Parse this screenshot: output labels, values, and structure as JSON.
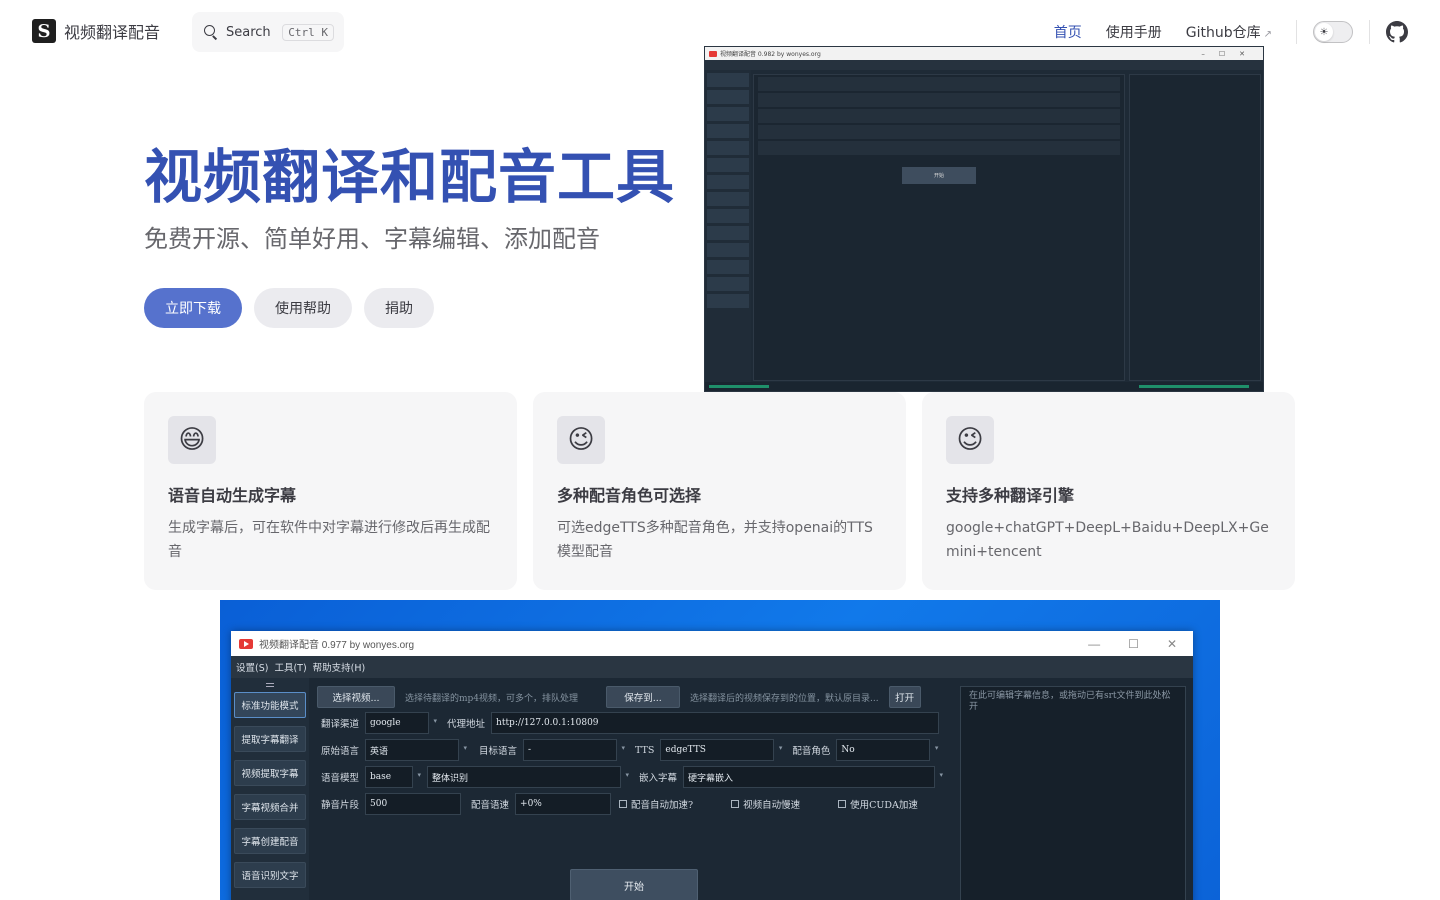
{
  "nav": {
    "brand": "视频翻译配音",
    "search_label": "Search",
    "search_shortcut": "Ctrl K",
    "links": [
      "首页",
      "使用手册",
      "Github仓库"
    ],
    "ext_arrow": "↗",
    "theme_icon": "sun-icon"
  },
  "hero": {
    "title": "视频翻译和配音工具",
    "tagline": "免费开源、简单好用、字幕编辑、添加配音",
    "actions": [
      "立即下载",
      "使用帮助",
      "捐助"
    ]
  },
  "features": [
    {
      "icon": "😄",
      "title": "语音自动生成字幕",
      "details": "生成字幕后，可在软件中对字幕进行修改后再生成配音"
    },
    {
      "icon": "😉",
      "title": "多种配音角色可选择",
      "details": "可选edgeTTS多种配音角色，并支持openai的TTS模型配音"
    },
    {
      "icon": "😉",
      "title": "支持多种翻译引擎",
      "details": "google+chatGPT+DeepL+Baidu+DeepLX+Gemini+tencent"
    }
  ],
  "colors": {
    "brand": "#3451b2",
    "button": "#5672cd"
  },
  "app": {
    "title": "视频翻译配音 0.977 by wonyes.org",
    "small_title": "视频翻译配音 0.982 by wonyes.org",
    "window_controls": [
      "—",
      "☐",
      "✕"
    ],
    "menu": [
      "设置(S)",
      "工具(T)",
      "帮助支持(H)"
    ],
    "sidebar": [
      "标准功能模式",
      "提取字幕翻译",
      "视频提取字幕",
      "字幕视频合并",
      "字幕创建配音",
      "语音识别文字"
    ],
    "select_video_btn": "选择视频...",
    "select_video_hint": "选择待翻译的mp4视频，可多个，排队处理",
    "save_btn": "保存到...",
    "save_hint": "选择翻译后的视频保存到的位置，默认原目录...",
    "open_btn": "打开",
    "fields": {
      "channel_label": "翻译渠道",
      "channel_value": "google",
      "proxy_label": "代理地址",
      "proxy_value": "http://127.0.0.1:10809",
      "source_label": "原始语言",
      "source_value": "英语",
      "target_label": "目标语言",
      "target_value": "-",
      "tts_label": "TTS",
      "tts_value": "edgeTTS",
      "role_label": "配音角色",
      "role_value": "No",
      "model_label": "语音模型",
      "model_value": "base",
      "recog_value": "整体识别",
      "embed_label": "嵌入字幕",
      "embed_value": "硬字幕嵌入",
      "silence_label": "静音片段",
      "silence_value": "500",
      "speed_label": "配音语速",
      "speed_value": "+0%"
    },
    "checks": [
      "配音自动加速?",
      "视频自动慢速",
      "使用CUDA加速"
    ],
    "start_btn": "开始",
    "right_hint": "在此可编辑字幕信息，或拖动已有srt文件到此处松开"
  }
}
